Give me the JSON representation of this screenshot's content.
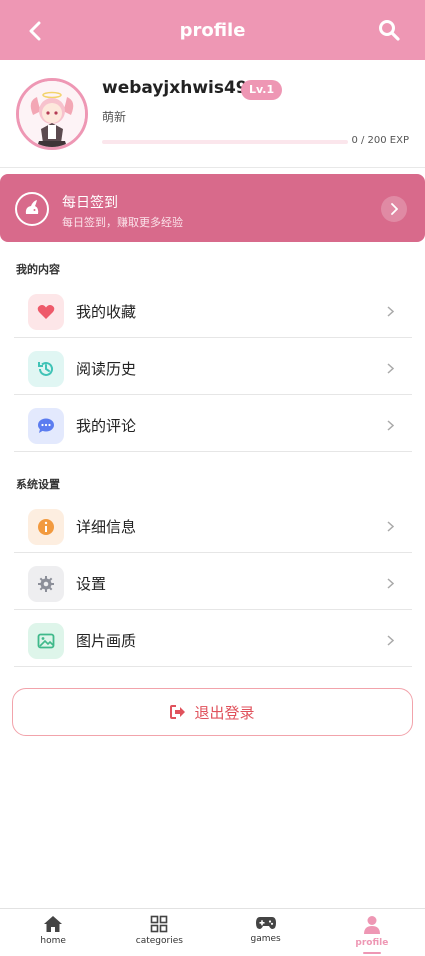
{
  "header": {
    "title": "profile",
    "back_icon": "chevron-left-icon",
    "search_icon": "search-icon",
    "bg_color": "#ee97b4"
  },
  "profile": {
    "username": "webayjxhwis491",
    "level": "Lv.1",
    "rank": "萌新",
    "exp_text": "0 / 200 EXP",
    "exp_progress": 0
  },
  "checkin": {
    "title": "每日签到",
    "subtitle": "每日签到，赚取更多经验",
    "icon": "rabbit-icon",
    "bg_color": "#d86a8b"
  },
  "sections": {
    "content_title": "我的内容",
    "content_items": [
      {
        "label": "我的收藏",
        "icon": "heart-icon",
        "color": "#ee5a6a"
      },
      {
        "label": "阅读历史",
        "icon": "history-icon",
        "color": "#3fc3b6"
      },
      {
        "label": "我的评论",
        "icon": "comment-icon",
        "color": "#5b7cf0"
      }
    ],
    "settings_title": "系统设置",
    "settings_items": [
      {
        "label": "详细信息",
        "icon": "info-icon",
        "color": "#f29a3f"
      },
      {
        "label": "设置",
        "icon": "gear-icon",
        "color": "#8c8f99"
      },
      {
        "label": "图片画质",
        "icon": "image-icon",
        "color": "#3fb98a"
      }
    ]
  },
  "logout": {
    "label": "退出登录",
    "icon": "logout-icon",
    "color": "#e0525c"
  },
  "bottom_nav": {
    "items": [
      {
        "label": "home",
        "icon": "home-icon"
      },
      {
        "label": "categories",
        "icon": "grid-icon"
      },
      {
        "label": "games",
        "icon": "gamepad-icon"
      },
      {
        "label": "profile",
        "icon": "user-icon"
      }
    ],
    "active": "profile",
    "active_color": "#ee97b4"
  }
}
